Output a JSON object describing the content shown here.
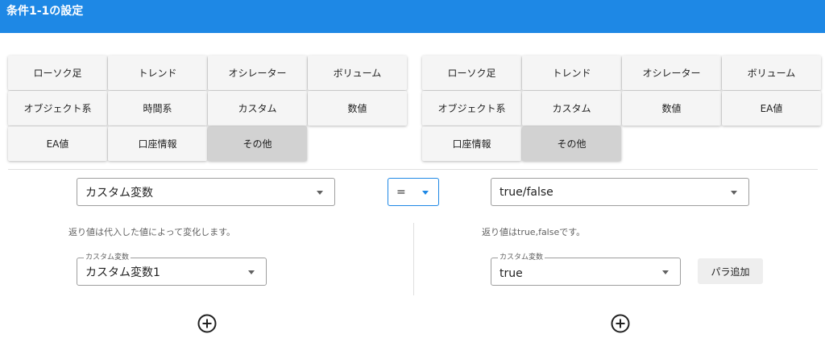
{
  "window": {
    "title": "条件1-1の設定"
  },
  "left_buttons": [
    "ローソク足",
    "トレンド",
    "オシレーター",
    "ボリューム",
    "オブジェクト系",
    "時間系",
    "カスタム",
    "数値",
    "EA値",
    "口座情報",
    "その他"
  ],
  "left_active_index": 10,
  "right_buttons": [
    "ローソク足",
    "トレンド",
    "オシレーター",
    "ボリューム",
    "オブジェクト系",
    "カスタム",
    "数値",
    "EA値",
    "口座情報",
    "その他"
  ],
  "right_active_index": 9,
  "left_panel": {
    "select_value": "カスタム変数",
    "description": "返り値は代入した値によって変化します。",
    "param_legend": "カスタム変数",
    "param_value": "カスタム変数1"
  },
  "operator": {
    "value": "="
  },
  "right_panel": {
    "select_value": "true/false",
    "description": "返り値はtrue,falseです。",
    "param_legend": "カスタム変数",
    "param_value": "true",
    "add_param_label": "パラ追加"
  }
}
